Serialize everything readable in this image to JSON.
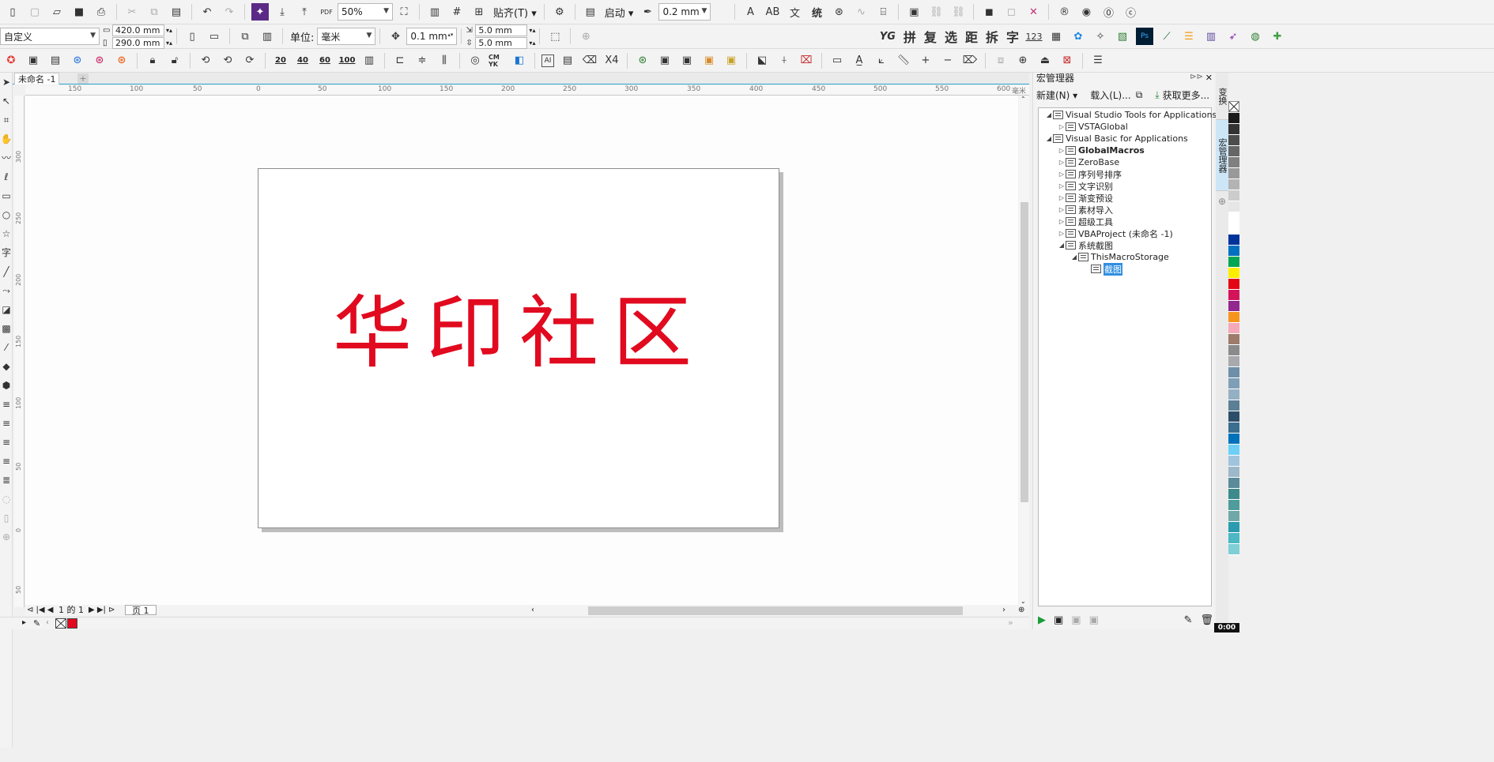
{
  "toolbar1": {
    "zoom": "50%",
    "snap_label": "贴齐(T)",
    "launch_label": "启动",
    "outline_width": "0.2 mm",
    "pdf_label": "PDF",
    "text_buttons": [
      "AB",
      "文",
      "统"
    ]
  },
  "toolbar2": {
    "page_preset": "自定义",
    "page_width": "420.0 mm",
    "page_height": "290.0 mm",
    "unit_label": "单位:",
    "unit_value": "毫米",
    "nudge": "0.1 mm",
    "dup_x": "5.0 mm",
    "dup_y": "5.0 mm",
    "tool_labels": [
      "YG",
      "拼",
      "复",
      "选",
      "距",
      "拆",
      "字",
      "123"
    ]
  },
  "toolbar3": {
    "num_buttons": [
      "20",
      "40",
      "60",
      "100"
    ],
    "cmyk_label": "CM YK",
    "ai_label": "AI",
    "x4_label": "X4"
  },
  "document": {
    "tab_title": "未命名 -1",
    "page_text": "华印社区",
    "text_color": "#e10a1f"
  },
  "ruler": {
    "h_labels": [
      "150",
      "100",
      "50",
      "0",
      "50",
      "100",
      "150",
      "200",
      "250",
      "300",
      "350",
      "400",
      "450",
      "500",
      "550",
      "600"
    ],
    "v_labels": [
      "300",
      "250",
      "200",
      "150",
      "100",
      "50",
      "0",
      "50"
    ],
    "unit": "毫米"
  },
  "pagenav": {
    "position": "1 的 1",
    "page_tab": "页 1"
  },
  "docker": {
    "title": "宏管理器",
    "new_label": "新建(N)",
    "load_label": "载入(L)...",
    "get_more_label": "获取更多...",
    "tree": [
      {
        "label": "Visual Studio Tools for Applications",
        "level": 0,
        "expanded": true
      },
      {
        "label": "VSTAGlobal",
        "level": 1,
        "expanded": false
      },
      {
        "label": "Visual Basic for Applications",
        "level": 0,
        "expanded": true
      },
      {
        "label": "GlobalMacros",
        "level": 1,
        "expanded": false,
        "bold": true
      },
      {
        "label": "ZeroBase",
        "level": 1,
        "expanded": false
      },
      {
        "label": "序列号排序",
        "level": 1,
        "expanded": false
      },
      {
        "label": "文字识别",
        "level": 1,
        "expanded": false
      },
      {
        "label": "渐变预设",
        "level": 1,
        "expanded": false
      },
      {
        "label": "素材导入",
        "level": 1,
        "expanded": false
      },
      {
        "label": "超级工具",
        "level": 1,
        "expanded": false
      },
      {
        "label": "VBAProject (未命名 -1)",
        "level": 1,
        "expanded": false
      },
      {
        "label": "系统截图",
        "level": 1,
        "expanded": true
      },
      {
        "label": "ThisMacroStorage",
        "level": 2,
        "expanded": true
      },
      {
        "label": "截图",
        "level": 3,
        "selected": true
      }
    ]
  },
  "sidetabs": [
    "变换",
    "宏管理器"
  ],
  "palette": [
    "#1a1a1a",
    "#333333",
    "#4d4d4d",
    "#666666",
    "#808080",
    "#999999",
    "#b3b3b3",
    "#cccccc",
    "#e6e6e6",
    "#ffffff",
    "#ffffff",
    "#003399",
    "#0070c0",
    "#00a651",
    "#ffed00",
    "#e30613",
    "#d4145a",
    "#92278f",
    "#f7941d",
    "#f5a9b8",
    "#9e7b6b",
    "#8b8b8b",
    "#a7a9ac",
    "#6d8fa8",
    "#7f9fb7",
    "#94b0c4",
    "#5b7f95",
    "#2d4e68",
    "#3a6e8f",
    "#0072bc",
    "#6dcff6",
    "#a0c4de",
    "#9db8c9",
    "#5b8a9a",
    "#3d8a8a",
    "#4e9c9c",
    "#70a8a8",
    "#2b9bb0",
    "#4bb8c4",
    "#7ecfd6"
  ],
  "clock": "0:00"
}
